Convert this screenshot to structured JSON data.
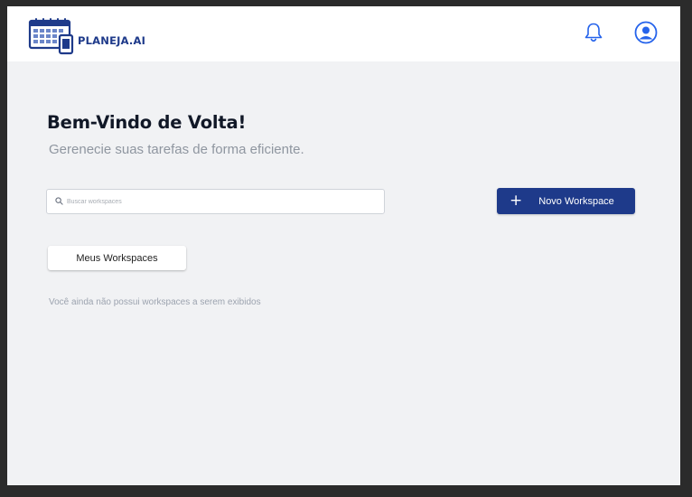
{
  "header": {
    "brand": "PLANEJA.AI",
    "logo_icon": "calendar-phone-icon",
    "notification_icon": "bell-icon",
    "profile_icon": "user-circle-icon"
  },
  "main": {
    "welcome": "Bem-Vindo de Volta!",
    "subtitle": "Gerenecie suas tarefas de forma eficiente.",
    "search": {
      "placeholder": "Buscar workspaces",
      "value": ""
    },
    "new_workspace": {
      "icon": "plus-icon",
      "plus_glyph": "+",
      "label": "Novo Workspace"
    },
    "tab_label": "Meus Workspaces",
    "empty_message": "Você ainda não possui workspaces a serem exibidos"
  },
  "colors": {
    "primary": "#1e3a8a",
    "background": "#f1f2f4",
    "header_bg": "#ffffff",
    "icon_blue": "#2563eb"
  }
}
